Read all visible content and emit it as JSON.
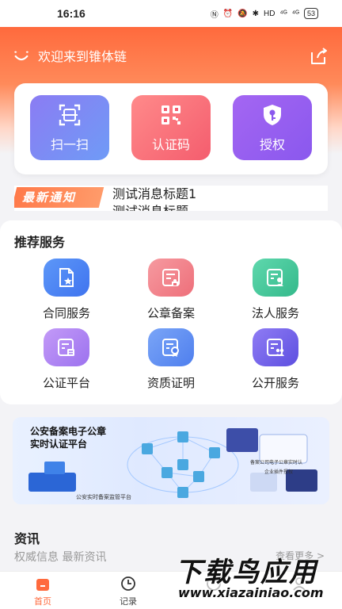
{
  "status": {
    "time": "16:16",
    "signal1": "⁴ᴳ",
    "signal2": "⁴ᴳ",
    "hd": "HD",
    "battery": "53"
  },
  "header": {
    "welcome": "欢迎来到锥体链"
  },
  "quick": {
    "scan": "扫一扫",
    "cert_code": "认证码",
    "authorize": "授权"
  },
  "notice": {
    "tag": "最新通知",
    "message": "测试消息标题1",
    "message2": "测试消息标题"
  },
  "services": {
    "title": "推荐服务",
    "items": [
      {
        "label": "合同服务",
        "color": "#4f86f7"
      },
      {
        "label": "公章备案",
        "color": "#f37b84"
      },
      {
        "label": "法人服务",
        "color": "#3fc79a"
      },
      {
        "label": "公证平台",
        "color": "#a77cf2"
      },
      {
        "label": "资质证明",
        "color": "#5b8ef3"
      },
      {
        "label": "公开服务",
        "color": "#7764ee"
      }
    ]
  },
  "banner": {
    "title_line1": "公安备案电子公章",
    "title_line2": "实时认证平台",
    "footer": "公安实时备案监管平台",
    "note1": "备案公司电子公章实时认",
    "note2": "企业插件授权"
  },
  "news": {
    "title": "资讯",
    "subtitle": "权威信息 最新资讯",
    "more": "查看更多 >"
  },
  "tabbar": {
    "home": "首页",
    "records": "记录",
    "tab3": "",
    "tab4": ""
  },
  "watermark": {
    "line1": "下载鸟应用",
    "line2": "www.xiazainiao.com"
  },
  "colors": {
    "accent": "#ff6a3d"
  }
}
